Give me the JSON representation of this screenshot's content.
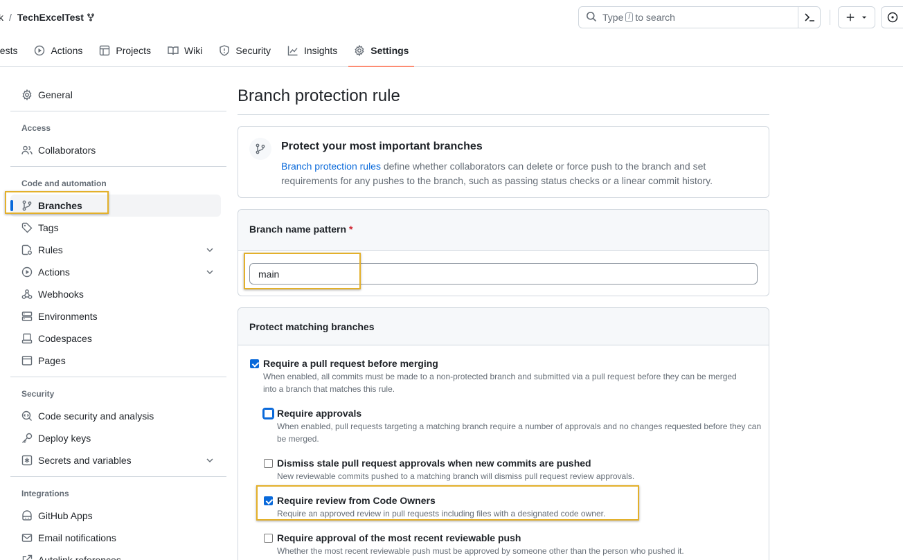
{
  "header": {
    "owner": "k",
    "separator": "/",
    "repo": "TechExcelTest",
    "search_placeholder_pre": "Type",
    "search_key": "/",
    "search_placeholder_post": "to search"
  },
  "tabs": [
    {
      "label": "uests"
    },
    {
      "label": "Actions"
    },
    {
      "label": "Projects"
    },
    {
      "label": "Wiki"
    },
    {
      "label": "Security"
    },
    {
      "label": "Insights"
    },
    {
      "label": "Settings"
    }
  ],
  "sidebar": {
    "general": "General",
    "access_heading": "Access",
    "collaborators": "Collaborators",
    "code_heading": "Code and automation",
    "branches": "Branches",
    "tags": "Tags",
    "rules": "Rules",
    "actions": "Actions",
    "webhooks": "Webhooks",
    "environments": "Environments",
    "codespaces": "Codespaces",
    "pages": "Pages",
    "security_heading": "Security",
    "code_security": "Code security and analysis",
    "deploy_keys": "Deploy keys",
    "secrets": "Secrets and variables",
    "integrations_heading": "Integrations",
    "github_apps": "GitHub Apps",
    "email_notifications": "Email notifications",
    "autolink": "Autolink references"
  },
  "main": {
    "title": "Branch protection rule",
    "intro_title": "Protect your most important branches",
    "intro_link": "Branch protection rules",
    "intro_text": " define whether collaborators can delete or force push to the branch and set requirements for any pushes to the branch, such as passing status checks or a linear commit history.",
    "pattern_label": "Branch name pattern",
    "pattern_required": "*",
    "pattern_value": "main",
    "protect_heading": "Protect matching branches",
    "rules": [
      {
        "title": "Require a pull request before merging",
        "desc": "When enabled, all commits must be made to a non-protected branch and submitted via a pull request before they can be merged into a branch that matches this rule.",
        "checked": true
      },
      {
        "title": "Require approvals",
        "desc": "When enabled, pull requests targeting a matching branch require a number of approvals and no changes requested before they can be merged.",
        "checked": false
      },
      {
        "title": "Dismiss stale pull request approvals when new commits are pushed",
        "desc": "New reviewable commits pushed to a matching branch will dismiss pull request review approvals.",
        "checked": false
      },
      {
        "title": "Require review from Code Owners",
        "desc": "Require an approved review in pull requests including files with a designated code owner.",
        "checked": true
      },
      {
        "title": "Require approval of the most recent reviewable push",
        "desc": "Whether the most recent reviewable push must be approved by someone other than the person who pushed it.",
        "checked": false
      }
    ]
  },
  "colors": {
    "accent": "#0969da",
    "highlight": "#e3b02a",
    "tab_underline": "#fd8c73"
  }
}
